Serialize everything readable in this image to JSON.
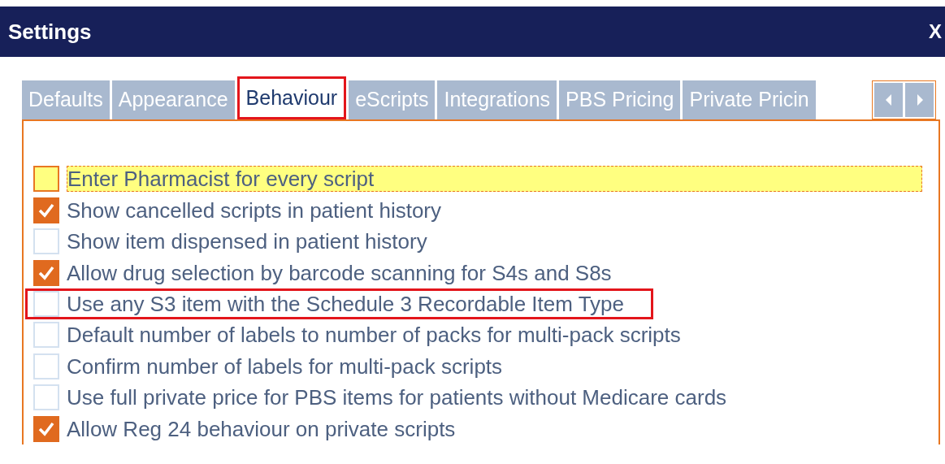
{
  "window": {
    "title": "Settings",
    "close": "X"
  },
  "tabs": [
    {
      "label": "Defaults",
      "selected": false,
      "annotated": false
    },
    {
      "label": "Appearance",
      "selected": false,
      "annotated": false
    },
    {
      "label": "Behaviour",
      "selected": true,
      "annotated": true
    },
    {
      "label": "eScripts",
      "selected": false,
      "annotated": false
    },
    {
      "label": "Integrations",
      "selected": false,
      "annotated": false
    },
    {
      "label": "PBS Pricing",
      "selected": false,
      "annotated": false
    },
    {
      "label": "Private Pricin",
      "selected": false,
      "annotated": false
    }
  ],
  "options": [
    {
      "label": "Enter Pharmacist for every script",
      "checked": false,
      "focused": true,
      "annotated": false
    },
    {
      "label": "Show cancelled scripts in patient history",
      "checked": true,
      "focused": false,
      "annotated": false
    },
    {
      "label": "Show item dispensed in patient history",
      "checked": false,
      "focused": false,
      "annotated": false
    },
    {
      "label": "Allow drug selection by barcode scanning for S4s and S8s",
      "checked": true,
      "focused": false,
      "annotated": false
    },
    {
      "label": "Use any S3 item with the Schedule 3 Recordable Item Type",
      "checked": false,
      "focused": false,
      "annotated": true
    },
    {
      "label": "Default number of labels to number of packs for multi-pack scripts",
      "checked": false,
      "focused": false,
      "annotated": false
    },
    {
      "label": "Confirm number of labels for multi-pack scripts",
      "checked": false,
      "focused": false,
      "annotated": false
    },
    {
      "label": "Use full private price for PBS items for patients without Medicare cards",
      "checked": false,
      "focused": false,
      "annotated": false
    },
    {
      "label": "Allow Reg 24 behaviour on private scripts",
      "checked": true,
      "focused": false,
      "annotated": false
    }
  ]
}
